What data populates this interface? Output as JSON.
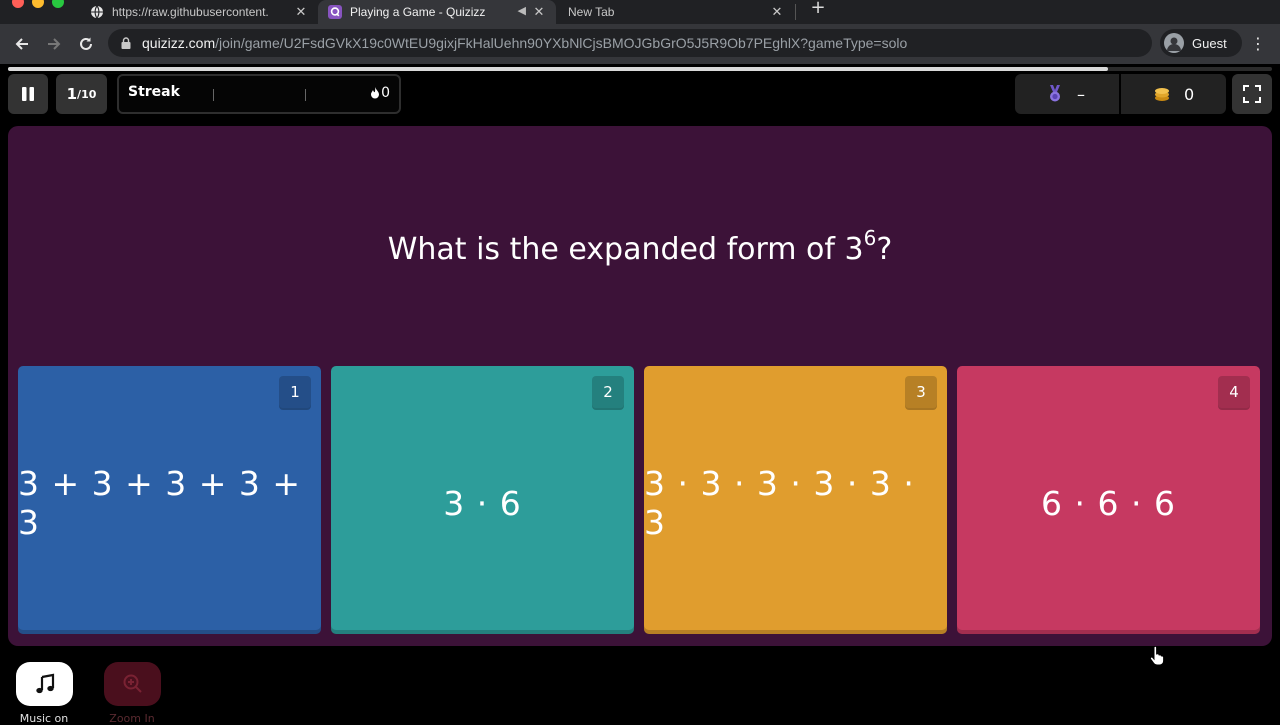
{
  "browser": {
    "tabs": [
      {
        "title": "https://raw.githubusercontent.",
        "active": false
      },
      {
        "title": "Playing a Game - Quizizz",
        "active": true
      },
      {
        "title": "New Tab",
        "active": false
      }
    ],
    "new_tab_label": "+",
    "url_host": "quizizz.com",
    "url_path": "/join/game/U2FsdGVkX19c0WtEU9gixjFkHalUehn90YXbNlCjsBMOJGbGrO5J5R9Ob7PEghlX?gameType=solo",
    "profile_label": "Guest",
    "colors": {
      "toolbar": "#35363a",
      "tabbar": "#202124"
    }
  },
  "hud": {
    "progress_fraction": 0.87,
    "question_index": "1",
    "question_total": "/10",
    "streak_label": "Streak",
    "streak_count": "0",
    "medal_value": "–",
    "coins_value": "0"
  },
  "question": {
    "text_before": "What is the expanded form of 3",
    "superscript": "6",
    "text_after": "?"
  },
  "options": [
    {
      "number": "1",
      "text": "3 + 3 + 3 + 3 + 3",
      "color": "#2c60a6"
    },
    {
      "number": "2",
      "text": "3 · 6",
      "color": "#2d9d9a"
    },
    {
      "number": "3",
      "text": "3 · 3 · 3 · 3 · 3 · 3",
      "color": "#e09d2e"
    },
    {
      "number": "4",
      "text": "6 · 6 · 6",
      "color": "#c63961"
    }
  ],
  "footer": {
    "music_label": "Music on",
    "zoom_label": "Zoom In"
  },
  "icons": [
    "globe-icon",
    "quizizz-icon",
    "speaker-mute-icon",
    "close-icon",
    "back-icon",
    "forward-icon",
    "reload-icon",
    "lock-icon",
    "avatar-icon",
    "kebab-icon",
    "pause-icon",
    "flame-icon",
    "medal-icon",
    "coins-icon",
    "fullscreen-icon",
    "music-icon",
    "zoom-in-icon",
    "hand-cursor-icon"
  ]
}
